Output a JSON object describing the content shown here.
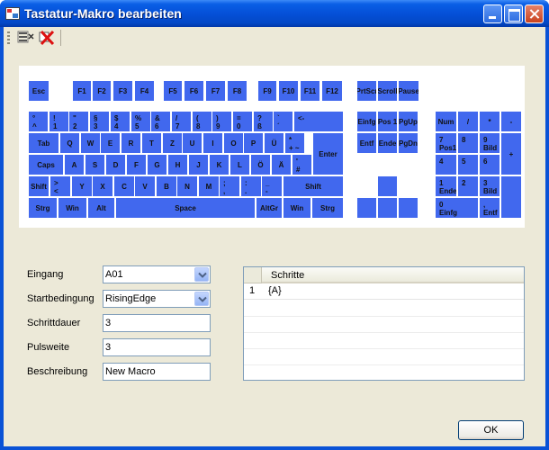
{
  "window": {
    "title": "Tastatur-Makro bearbeiten"
  },
  "toolbar": {
    "edit_icon": "edit-macro-icon",
    "delete_icon": "delete-red-x-icon"
  },
  "keyboard": {
    "key_color": "#4168ee",
    "function_row": [
      "Esc",
      "F1",
      "F2",
      "F3",
      "F4",
      "F5",
      "F6",
      "F7",
      "F8",
      "F9",
      "F10",
      "F11",
      "F12",
      "PrtScr",
      "Scroll",
      "Pause"
    ],
    "number_row": [
      "°\n^",
      "!\n1",
      "\"\n2",
      "§\n3",
      "$\n4",
      "%\n5",
      "&\n6",
      "/\n7",
      "(\n8",
      ")\n9",
      "=\n0",
      "?\nß",
      "`\n´",
      "<-"
    ],
    "qwertz_row": [
      "Tab",
      "Q",
      "W",
      "E",
      "R",
      "T",
      "Z",
      "U",
      "I",
      "O",
      "P",
      "Ü",
      "*\n+ ~",
      "Enter"
    ],
    "home_row": [
      "Caps",
      "A",
      "S",
      "D",
      "F",
      "G",
      "H",
      "J",
      "K",
      "L",
      "Ö",
      "Ä",
      "'\n#"
    ],
    "shift_row": [
      "Shift",
      ">\n<",
      "Y",
      "X",
      "C",
      "V",
      "B",
      "N",
      "M",
      ";\n,",
      ":\n.",
      "_\n-",
      "Shift"
    ],
    "bottom_row": [
      "Strg",
      "Win",
      "Alt",
      "Space",
      "AltGr",
      "Win",
      "Strg"
    ],
    "nav_block": [
      "Einfg",
      "Pos 1",
      "PgUp",
      "Entf",
      "Ende",
      "PgDn"
    ],
    "numpad": [
      "Num",
      "/",
      "*",
      "-",
      "7\nPos1",
      "8",
      "9\nBild",
      "+",
      "4",
      "5",
      "6",
      "1\nEnde",
      "2",
      "3\nBild",
      "0\nEinfg",
      ",\nEntf"
    ]
  },
  "form": {
    "eingang_label": "Eingang",
    "eingang_value": "A01",
    "startbedingung_label": "Startbedingung",
    "startbedingung_value": "RisingEdge",
    "schrittdauer_label": "Schrittdauer",
    "schrittdauer_value": "3",
    "pulsweite_label": "Pulsweite",
    "pulsweite_value": "3",
    "beschreibung_label": "Beschreibung",
    "beschreibung_value": "New Macro"
  },
  "steps_grid": {
    "column_header": "Schritte",
    "rows": [
      {
        "index": "1",
        "step": "{A}"
      }
    ]
  },
  "ok_label": "OK"
}
